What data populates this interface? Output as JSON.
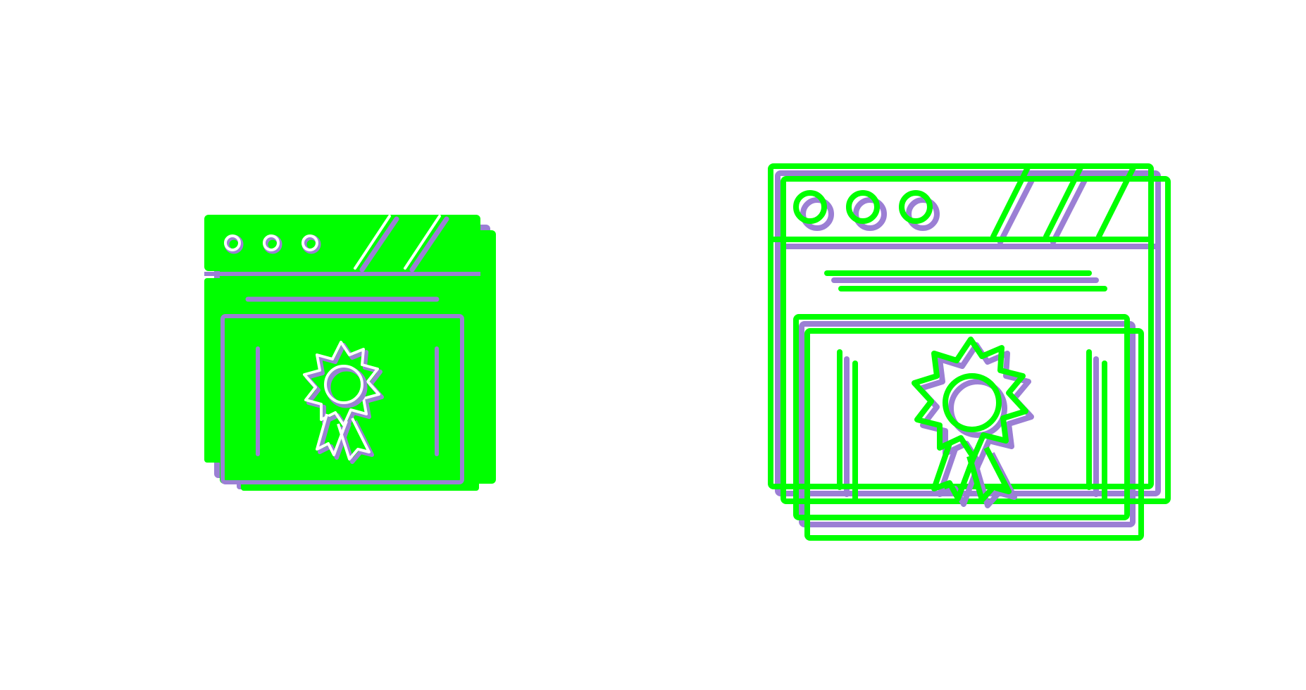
{
  "icons": [
    {
      "name": "website-certificate-icon",
      "style": "filled",
      "colors": {
        "primary": "#00ff00",
        "shadow": "#9b7fd4",
        "background": "#ffffff"
      }
    },
    {
      "name": "website-certificate-icon",
      "style": "outline",
      "colors": {
        "primary": "#00ff00",
        "shadow": "#9b7fd4",
        "background": "#ffffff"
      }
    }
  ]
}
